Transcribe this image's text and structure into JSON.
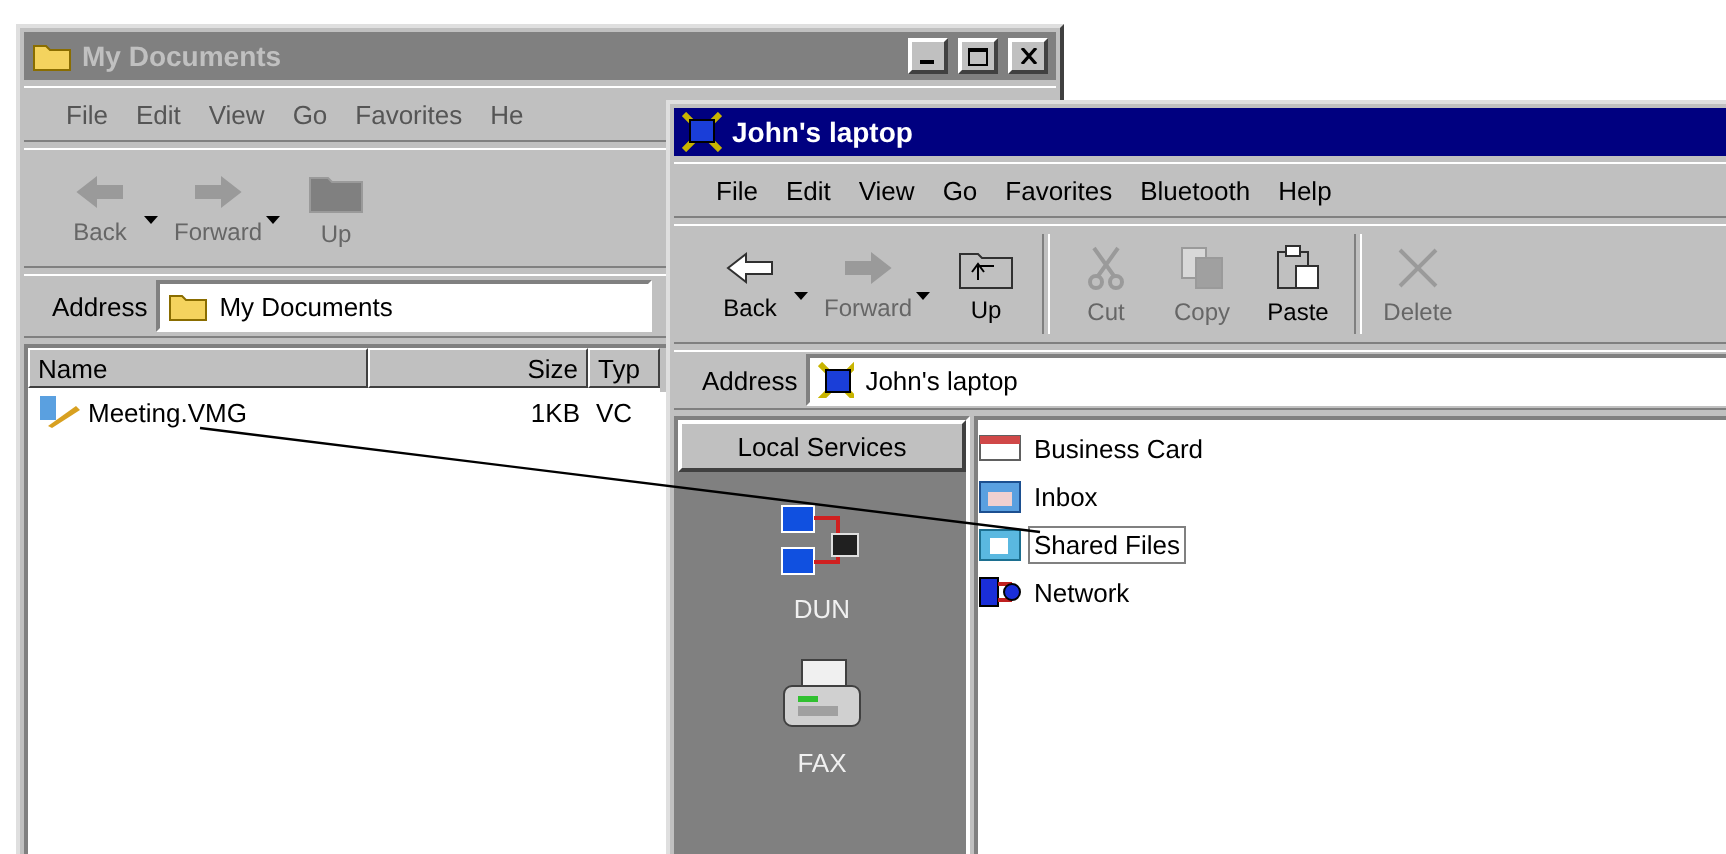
{
  "back_window": {
    "title": "My Documents",
    "active": false,
    "menu": [
      "File",
      "Edit",
      "View",
      "Go",
      "Favorites",
      "He"
    ],
    "toolbar": [
      {
        "label": "Back",
        "kind": "back",
        "disabled": true
      },
      {
        "label": "Forward",
        "kind": "forward",
        "disabled": true
      },
      {
        "label": "Up",
        "kind": "up",
        "disabled": true
      }
    ],
    "address_label": "Address",
    "address": "My Documents",
    "columns": [
      "Name",
      "Size",
      "Typ"
    ],
    "rows": [
      {
        "name": "Meeting.VMG",
        "size": "1KB",
        "type": "VC"
      }
    ]
  },
  "front_window": {
    "title": "John's laptop",
    "active": true,
    "menu": [
      "File",
      "Edit",
      "View",
      "Go",
      "Favorites",
      "Bluetooth",
      "Help"
    ],
    "toolbar": [
      {
        "label": "Back",
        "kind": "back",
        "disabled": false
      },
      {
        "label": "Forward",
        "kind": "forward",
        "disabled": true
      },
      {
        "label": "Up",
        "kind": "up",
        "disabled": false
      },
      {
        "label": "Cut",
        "kind": "cut",
        "disabled": true
      },
      {
        "label": "Copy",
        "kind": "copy",
        "disabled": true
      },
      {
        "label": "Paste",
        "kind": "paste",
        "disabled": false
      },
      {
        "label": "Delete",
        "kind": "delete",
        "disabled": true
      }
    ],
    "address_label": "Address",
    "address": "John's laptop",
    "services": {
      "header": "Local Services",
      "items": [
        {
          "label": "DUN",
          "kind": "dun"
        },
        {
          "label": "FAX",
          "kind": "fax"
        }
      ]
    },
    "items": [
      {
        "label": "Business Card",
        "kind": "card",
        "selected": false
      },
      {
        "label": "Inbox",
        "kind": "inbox",
        "selected": false
      },
      {
        "label": "Shared Files",
        "kind": "shared",
        "selected": true
      },
      {
        "label": "Network",
        "kind": "network",
        "selected": false
      }
    ]
  }
}
